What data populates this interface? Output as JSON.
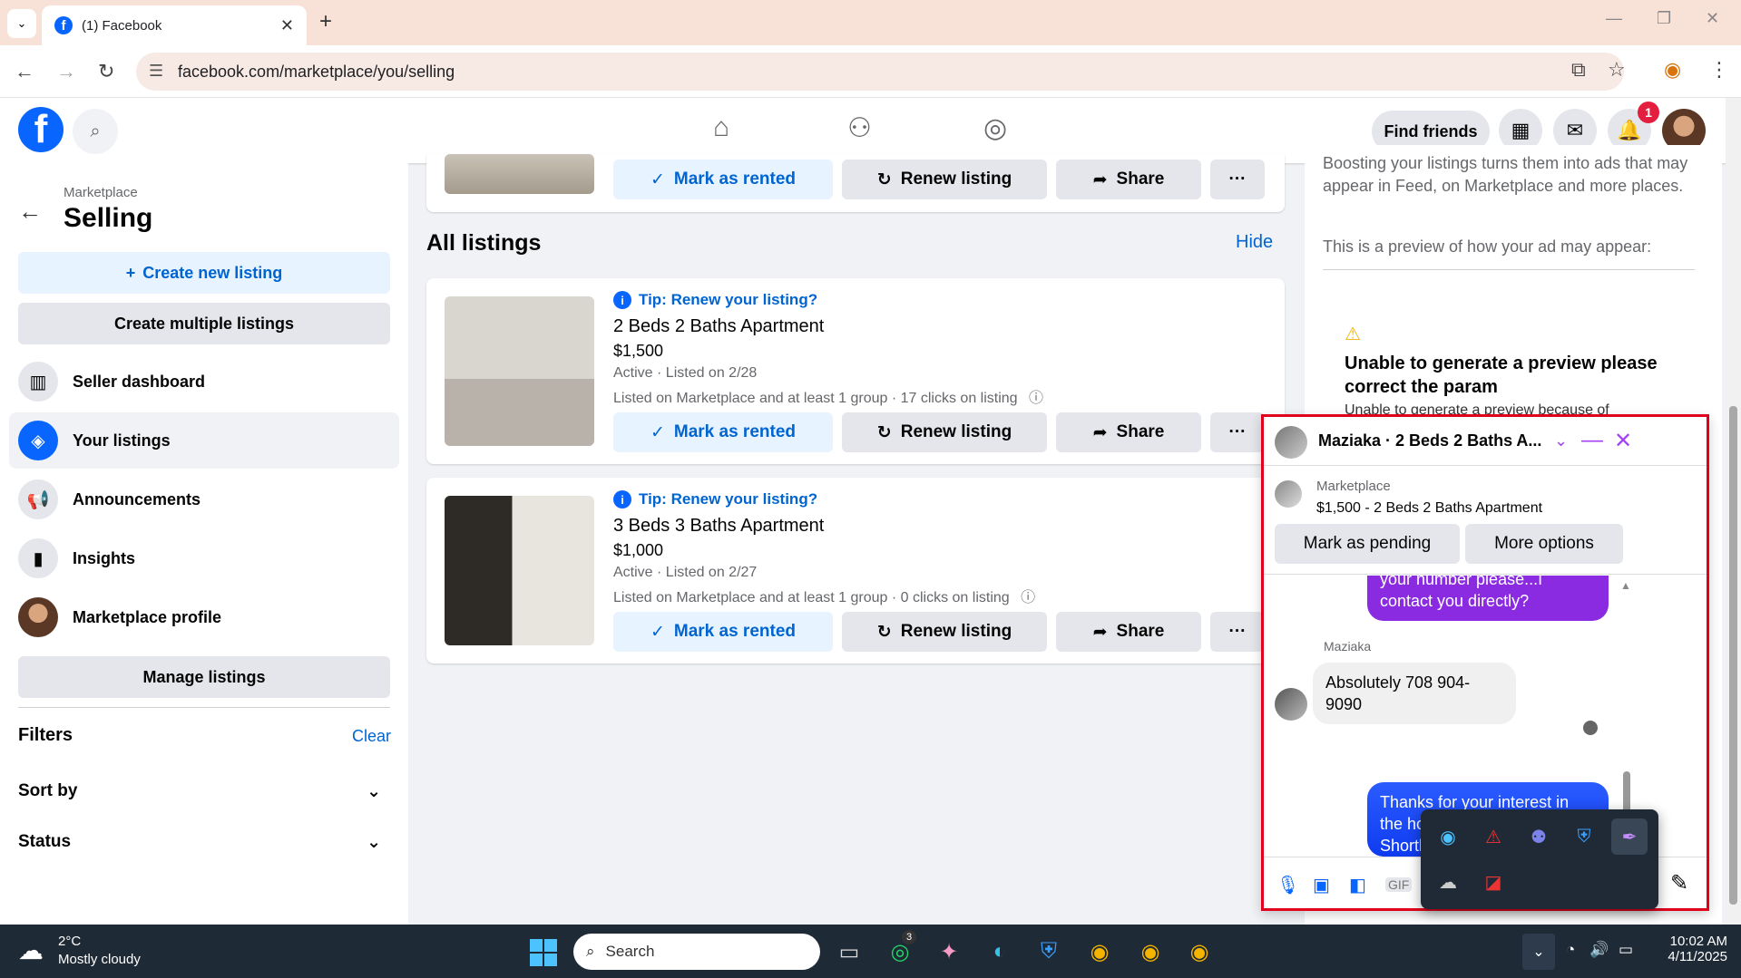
{
  "browser": {
    "tab_title": "(1) Facebook",
    "url": "facebook.com/marketplace/you/selling"
  },
  "fb": {
    "find_friends": "Find friends",
    "notif_count": "1"
  },
  "sidebar": {
    "crumb": "Marketplace",
    "title": "Selling",
    "create_new": "Create new listing",
    "create_multi": "Create multiple listings",
    "items": [
      {
        "label": "Seller dashboard"
      },
      {
        "label": "Your listings"
      },
      {
        "label": "Announcements"
      },
      {
        "label": "Insights"
      },
      {
        "label": "Marketplace profile"
      }
    ],
    "manage": "Manage listings",
    "filters": "Filters",
    "clear": "Clear",
    "sort_by": "Sort by",
    "status": "Status"
  },
  "listings": {
    "section_title": "All listings",
    "hide": "Hide",
    "buttons": {
      "rent": "Mark as rented",
      "renew": "Renew listing",
      "share": "Share",
      "more": "···"
    },
    "items": [
      {
        "tip": "Tip: Renew your listing?",
        "title": "2 Beds 2 Baths Apartment",
        "price": "$1,500",
        "status": "Active · Listed on 2/28",
        "reach": "Listed on Marketplace and at least 1 group · 17 clicks on listing"
      },
      {
        "tip": "Tip: Renew your listing?",
        "title": "3 Beds 3 Baths Apartment",
        "price": "$1,000",
        "status": "Active · Listed on 2/27",
        "reach": "Listed on Marketplace and at least 1 group · 0 clicks on listing"
      }
    ]
  },
  "right_panel": {
    "boost_text": "Boosting your listings turns them into ads that may appear in Feed, on Marketplace and more places.",
    "preview_text": "This is a preview of how your ad may appear:",
    "error_title": "Unable to generate a preview please correct the param",
    "error_sub": "Unable to generate a preview because of"
  },
  "chat": {
    "name": "Maziaka · 2 Beds 2 Baths A...",
    "mp_label": "Marketplace",
    "mp_listing": "$1,500 - 2 Beds 2 Baths Apartment",
    "mark_pending": "Mark as pending",
    "more_options": "More options",
    "msg_out_1": "your number please...I contact you directly?",
    "sender": "Maziaka",
    "msg_in": "Absolutely 708 904-9090",
    "msg_out_2": "Thanks for your interest in the houseI will reach out Shortly",
    "gif": "GIF"
  },
  "taskbar": {
    "temp": "2°C",
    "condition": "Mostly cloudy",
    "search": "Search",
    "whatsapp_badge": "3",
    "time": "10:02 AM",
    "date": "4/11/2025"
  }
}
